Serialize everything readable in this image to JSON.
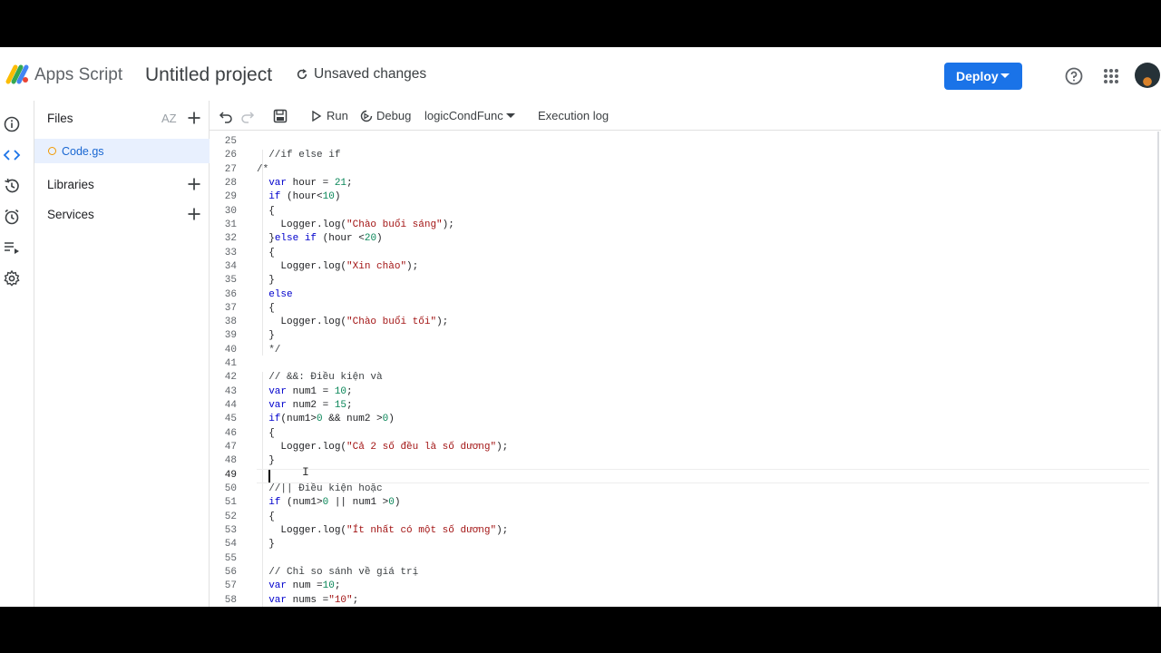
{
  "app": {
    "name": "Apps Script",
    "project_title": "Untitled project",
    "save_status": "Unsaved changes",
    "deploy_label": "Deploy",
    "accent": "#1a73e8"
  },
  "files_panel": {
    "files_label": "Files",
    "sort_label": "AZ",
    "file_name": "Code.gs",
    "libraries_label": "Libraries",
    "services_label": "Services"
  },
  "toolbar": {
    "run_label": "Run",
    "debug_label": "Debug",
    "function_name": "logicCondFunc",
    "execution_log_label": "Execution log"
  },
  "editor": {
    "current_line": 49,
    "lines": [
      {
        "n": "25",
        "t": ""
      },
      {
        "n": "26",
        "t": "  //if else if"
      },
      {
        "n": "27",
        "t": "/*"
      },
      {
        "n": "28",
        "t": "  var hour = 21;"
      },
      {
        "n": "29",
        "t": "  if (hour<10)"
      },
      {
        "n": "30",
        "t": "  {"
      },
      {
        "n": "31",
        "t": "    Logger.log(\"Chào buổi sáng\");"
      },
      {
        "n": "32",
        "t": "  }else if (hour <20)"
      },
      {
        "n": "33",
        "t": "  {"
      },
      {
        "n": "34",
        "t": "    Logger.log(\"Xin chào\");"
      },
      {
        "n": "35",
        "t": "  }"
      },
      {
        "n": "36",
        "t": "  else"
      },
      {
        "n": "37",
        "t": "  {"
      },
      {
        "n": "38",
        "t": "    Logger.log(\"Chào buổi tối\");"
      },
      {
        "n": "39",
        "t": "  }"
      },
      {
        "n": "40",
        "t": "  */"
      },
      {
        "n": "41",
        "t": ""
      },
      {
        "n": "42",
        "t": "  // &&: Điều kiện và"
      },
      {
        "n": "43",
        "t": "  var num1 = 10;"
      },
      {
        "n": "44",
        "t": "  var num2 = 15;"
      },
      {
        "n": "45",
        "t": "  if(num1>0 && num2 >0)"
      },
      {
        "n": "46",
        "t": "  {"
      },
      {
        "n": "47",
        "t": "    Logger.log(\"Cả 2 số đều là số dương\");"
      },
      {
        "n": "48",
        "t": "  }"
      },
      {
        "n": "49",
        "t": ""
      },
      {
        "n": "50",
        "t": "  //|| Điều kiện hoặc"
      },
      {
        "n": "51",
        "t": "  if (num1>0 || num1 >0)"
      },
      {
        "n": "52",
        "t": "  {"
      },
      {
        "n": "53",
        "t": "    Logger.log(\"Ít nhất có một số dương\");"
      },
      {
        "n": "54",
        "t": "  }"
      },
      {
        "n": "55",
        "t": ""
      },
      {
        "n": "56",
        "t": "  // Chỉ so sánh về giá trị"
      },
      {
        "n": "57",
        "t": "  var num =10;"
      },
      {
        "n": "58",
        "t": "  var nums =\"10\";"
      }
    ]
  }
}
